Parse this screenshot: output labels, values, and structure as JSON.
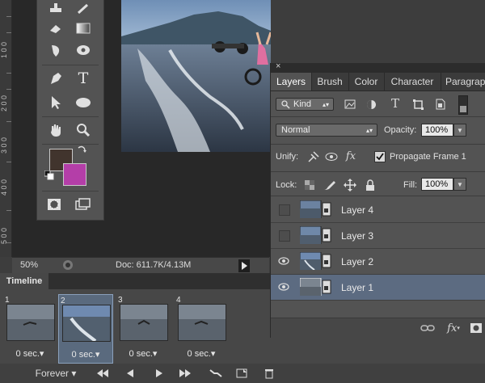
{
  "ruler": {
    "ticks": [
      "1 0 0",
      "2 0 0",
      "3 0 0",
      "4 0 0",
      "5 0 0"
    ]
  },
  "status_bar": {
    "zoom": "50%",
    "doc_info": "Doc: 611.7K/4.13M"
  },
  "layers_panel": {
    "tabs": [
      "Layers",
      "Brush",
      "Color",
      "Character",
      "Paragrap"
    ],
    "active_tab": "Layers",
    "filter_kind": "Kind",
    "blend_mode": "Normal",
    "opacity_label": "Opacity:",
    "opacity_value": "100%",
    "unify_label": "Unify:",
    "propagate_label": "Propagate Frame 1",
    "propagate_checked": true,
    "lock_label": "Lock:",
    "fill_label": "Fill:",
    "fill_value": "100%",
    "layers": [
      {
        "name": "Layer 4",
        "visible": false,
        "selected": false
      },
      {
        "name": "Layer 3",
        "visible": false,
        "selected": false
      },
      {
        "name": "Layer 2",
        "visible": true,
        "selected": false
      },
      {
        "name": "Layer 1",
        "visible": true,
        "selected": true
      }
    ]
  },
  "timeline": {
    "tab_label": "Timeline",
    "frames": [
      {
        "number": "1",
        "delay": "0 sec.",
        "selected": false
      },
      {
        "number": "2",
        "delay": "0 sec.",
        "selected": true
      },
      {
        "number": "3",
        "delay": "0 sec.",
        "selected": false
      },
      {
        "number": "4",
        "delay": "0 sec.",
        "selected": false
      }
    ],
    "loop_option": "Forever"
  },
  "colors": {
    "foreground": "#41342d",
    "background": "#b43ea8",
    "selection": "#5c6b81"
  }
}
